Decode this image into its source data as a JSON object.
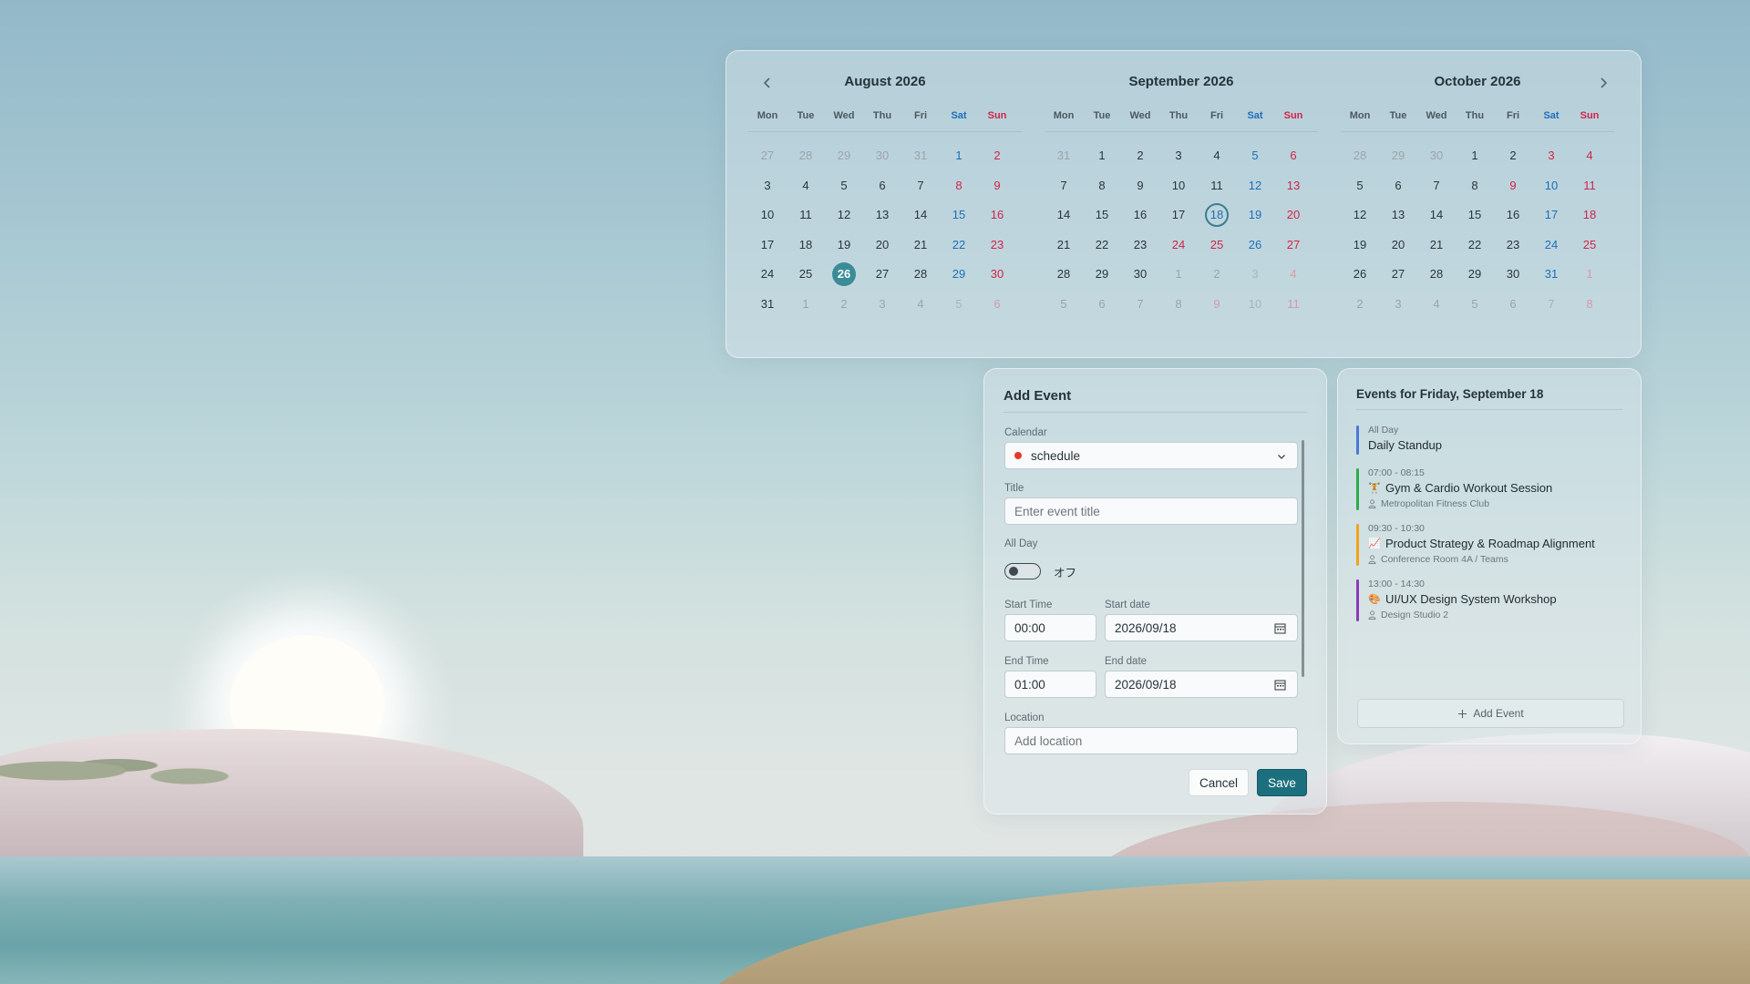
{
  "calendar": {
    "prev_icon": "chevron-left-icon",
    "next_icon": "chevron-right-icon",
    "weekdays": [
      "Mon",
      "Tue",
      "Wed",
      "Thu",
      "Fri",
      "Sat",
      "Sun"
    ],
    "months": [
      {
        "title": "August 2026",
        "days": [
          "27",
          "28",
          "29",
          "30",
          "31",
          "1",
          "2",
          "3",
          "4",
          "5",
          "6",
          "7",
          "8",
          "9",
          "10",
          "11",
          "12",
          "13",
          "14",
          "15",
          "16",
          "17",
          "18",
          "19",
          "20",
          "21",
          "22",
          "23",
          "24",
          "25",
          "26",
          "27",
          "28",
          "29",
          "30",
          "31",
          "1",
          "2",
          "3",
          "4",
          "5",
          "6"
        ],
        "muted": [
          0,
          1,
          2,
          3,
          4,
          36,
          37,
          38,
          39,
          40,
          41
        ],
        "holidays": [
          12
        ],
        "today": 30
      },
      {
        "title": "September 2026",
        "days": [
          "31",
          "1",
          "2",
          "3",
          "4",
          "5",
          "6",
          "7",
          "8",
          "9",
          "10",
          "11",
          "12",
          "13",
          "14",
          "15",
          "16",
          "17",
          "18",
          "19",
          "20",
          "21",
          "22",
          "23",
          "24",
          "25",
          "26",
          "27",
          "28",
          "29",
          "30",
          "1",
          "2",
          "3",
          "4",
          "5",
          "6",
          "7",
          "8",
          "9",
          "10",
          "11"
        ],
        "muted": [
          0,
          31,
          32,
          33,
          34,
          35,
          36,
          37,
          38,
          39,
          40,
          41
        ],
        "holidays": [
          24,
          25,
          39
        ],
        "selected": 18
      },
      {
        "title": "October 2026",
        "days": [
          "28",
          "29",
          "30",
          "1",
          "2",
          "3",
          "4",
          "5",
          "6",
          "7",
          "8",
          "9",
          "10",
          "11",
          "12",
          "13",
          "14",
          "15",
          "16",
          "17",
          "18",
          "19",
          "20",
          "21",
          "22",
          "23",
          "24",
          "25",
          "26",
          "27",
          "28",
          "29",
          "30",
          "31",
          "1",
          "2",
          "3",
          "4",
          "5",
          "6",
          "7",
          "8"
        ],
        "muted": [
          0,
          1,
          2,
          34,
          35,
          36,
          37,
          38,
          39,
          40,
          41
        ],
        "holidays": [
          5,
          11
        ],
        "today": -1
      }
    ]
  },
  "form": {
    "title": "Add Event",
    "calendar_label": "Calendar",
    "calendar_value": "schedule",
    "title_label": "Title",
    "title_placeholder": "Enter event title",
    "allday_label": "All Day",
    "allday_state": "オフ",
    "start_time_label": "Start Time",
    "start_time": "00:00",
    "start_date_label": "Start date",
    "start_date": "2026/09/18",
    "end_time_label": "End Time",
    "end_time": "01:00",
    "end_date_label": "End date",
    "end_date": "2026/09/18",
    "location_label": "Location",
    "location_placeholder": "Add location",
    "cancel_label": "Cancel",
    "save_label": "Save",
    "accent_color": "#1c6f7d",
    "calendar_dot_color": "#e23b2a"
  },
  "events_panel": {
    "title": "Events for Friday, September 18",
    "events": [
      {
        "time": "All Day",
        "title": "Daily Standup",
        "emoji": "",
        "location": "",
        "color": "#4a78d6"
      },
      {
        "time": "07:00 - 08:15",
        "title": "Gym & Cardio Workout Session",
        "emoji": "🏋",
        "location": "Metropolitan Fitness Club",
        "color": "#2faa4e"
      },
      {
        "time": "09:30 - 10:30",
        "title": "Product Strategy & Roadmap Alignment",
        "emoji": "📈",
        "location": "Conference Room 4A / Teams",
        "color": "#f2a21b"
      },
      {
        "time": "13:00 - 14:30",
        "title": "UI/UX Design System Workshop",
        "emoji": "🎨",
        "location": "Design Studio 2",
        "color": "#8a3bb8"
      }
    ],
    "add_label": "Add Event"
  }
}
